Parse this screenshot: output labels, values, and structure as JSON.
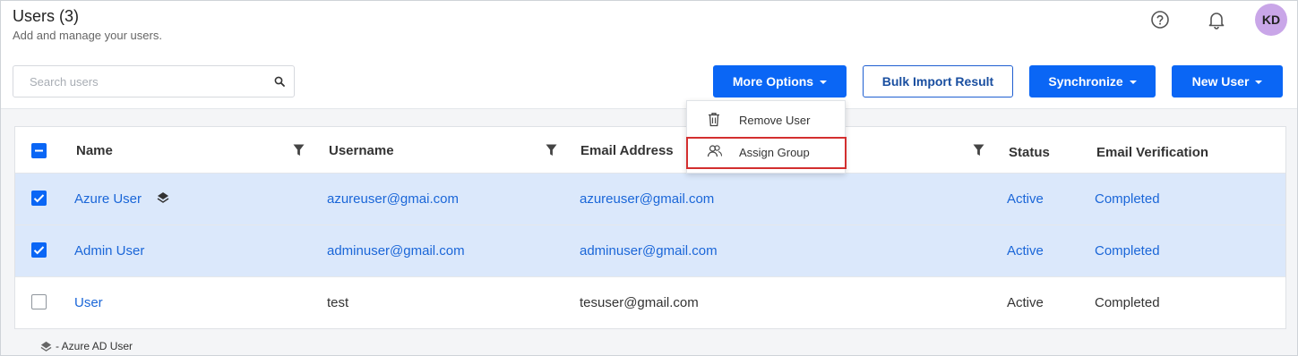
{
  "header": {
    "title": "Users (3)",
    "subtitle": "Add and manage your users.",
    "avatar_initials": "KD",
    "help_icon": "question-circle-icon",
    "bell_icon": "bell-icon"
  },
  "search": {
    "placeholder": "Search users",
    "icon": "search-icon"
  },
  "toolbar": {
    "more_options_label": "More Options",
    "bulk_import_label": "Bulk Import Result",
    "synchronize_label": "Synchronize",
    "new_user_label": "New User"
  },
  "dropdown": {
    "items": [
      {
        "label": "Remove User",
        "icon": "trash-icon"
      },
      {
        "label": "Assign Group",
        "icon": "users-group-icon"
      }
    ]
  },
  "table": {
    "columns": [
      "Name",
      "Username",
      "Email Address",
      "Status",
      "Email Verification"
    ],
    "rows": [
      {
        "name": "Azure User",
        "username": "azureuser@gmai.com",
        "email": "azureuser@gmail.com",
        "status": "Active",
        "verification": "Completed",
        "selected": true,
        "azure": true
      },
      {
        "name": "Admin User",
        "username": "adminuser@gmail.com",
        "email": "adminuser@gmail.com",
        "status": "Active",
        "verification": "Completed",
        "selected": true,
        "azure": false
      },
      {
        "name": "User",
        "username": "test",
        "email": "tesuser@gmail.com",
        "status": "Active",
        "verification": "Completed",
        "selected": false,
        "azure": false
      }
    ]
  },
  "legend": {
    "text": "- Azure AD User",
    "icon": "azure-layers-icon"
  },
  "colors": {
    "primary": "#0a66f5",
    "link": "#1a66d8",
    "selected_row": "#dbe8fb",
    "avatar": "#c9a6e8",
    "highlight_border": "#d32f2f"
  }
}
